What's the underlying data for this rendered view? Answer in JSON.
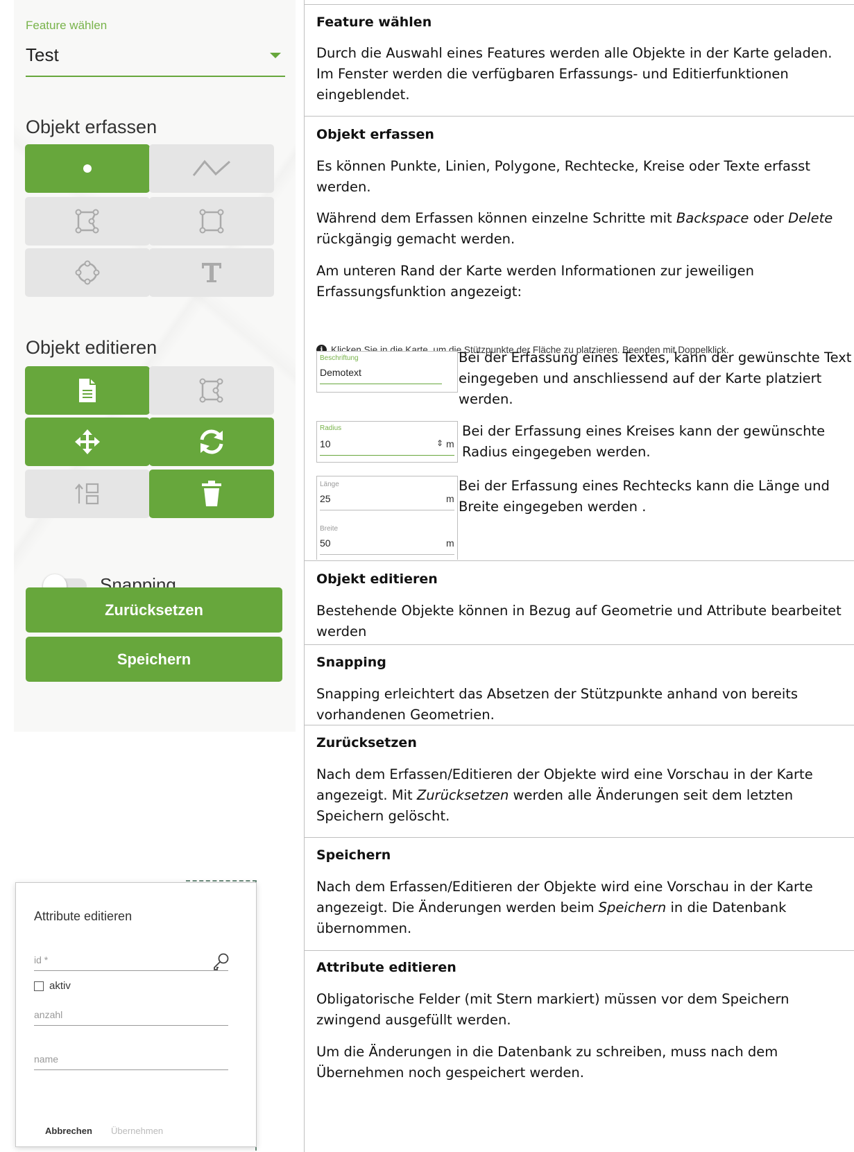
{
  "left": {
    "feature": {
      "label": "Feature wählen",
      "value": "Test"
    },
    "capture": {
      "title": "Objekt erfassen",
      "tools": [
        {
          "icon": "point-icon",
          "active": true
        },
        {
          "icon": "line-icon",
          "active": false
        },
        {
          "icon": "polygon-icon",
          "active": false
        },
        {
          "icon": "rectangle-icon",
          "active": false
        },
        {
          "icon": "circle-icon",
          "active": false
        },
        {
          "icon": "text-icon",
          "active": false
        }
      ]
    },
    "edit": {
      "title": "Objekt editieren",
      "tools": [
        {
          "icon": "document-icon",
          "active": true
        },
        {
          "icon": "edit-polygon-icon",
          "active": false
        },
        {
          "icon": "move-icon",
          "active": true
        },
        {
          "icon": "rotate-icon",
          "active": true
        },
        {
          "icon": "order-icon",
          "active": false
        },
        {
          "icon": "trash-icon",
          "active": true
        }
      ]
    },
    "snapping_label": "Snapping",
    "reset_label": "Zurücksetzen",
    "save_label": "Speichern",
    "dialog": {
      "title": "Attribute editieren",
      "id_label": "id *",
      "aktiv_label": "aktiv",
      "anzahl_label": "anzahl",
      "name_label": "name",
      "cancel_label": "Abbrechen",
      "ok_label": "Übernehmen"
    }
  },
  "right": {
    "feature_title": "Feature wählen",
    "feature_text": "Durch die Auswahl eines Features werden alle Objekte in der Karte geladen. Im Fenster werden die verfügbaren Erfassungs- und Editierfunktionen eingeblendet.",
    "capture_title": "Objekt erfassen",
    "capture_p1": "Es können Punkte, Linien, Polygone, Rechtecke, Kreise oder Texte erfasst werden.",
    "capture_p2_a": "Während dem Erfassen können einzelne Schritte mit ",
    "capture_p2_b": "Backspace",
    "capture_p2_c": " oder ",
    "capture_p2_d": "Delete",
    "capture_p2_e": " rückgängig gemacht werden.",
    "capture_p3": "Am unteren Rand der Karte werden Informationen zur jeweiligen Erfassungsfunktion angezeigt:",
    "info_text": "Klicken Sie in die Karte, um die Stützpunkte der Fläche zu platzieren. Beenden mit Doppelklick.",
    "text_box": {
      "label": "Beschriftung",
      "value": "Demotext"
    },
    "text_desc": "Bei der Erfassung eines Textes, kann der gewünschte Text eingegeben und anschliessend auf der Karte platziert werden.",
    "radius_box": {
      "label": "Radius",
      "value": "10",
      "unit": "m",
      "spinner": "⇕"
    },
    "radius_desc": "Bei der Erfassung eines Kreises kann der gewünschte Radius eingegeben werden.",
    "rect_box": {
      "len_label": "Länge",
      "len_value": "25",
      "width_label": "Breite",
      "width_value": "50",
      "unit": "m"
    },
    "rect_desc": "Bei der Erfassung eines Rechtecks kann die Länge und Breite eingegeben werden .",
    "edit_title": "Objekt editieren",
    "edit_text": "Bestehende Objekte können in Bezug auf Geometrie und Attribute bearbeitet werden",
    "snap_title": "Snapping",
    "snap_text": "Snapping erleichtert das Absetzen der Stützpunkte anhand von bereits vorhandenen Geometrien.",
    "reset_title": "Zurücksetzen",
    "reset_a": "Nach dem Erfassen/Editieren der Objekte wird eine Vorschau in der Karte angezeigt. Mit ",
    "reset_b": "Zurücksetzen",
    "reset_c": " werden alle Änderungen seit dem letzten Speichern gelöscht.",
    "save_title": "Speichern",
    "save_a": "Nach dem Erfassen/Editieren der Objekte wird eine Vorschau in der Karte angezeigt. Die Änderungen werden beim ",
    "save_b": "Speichern",
    "save_c": " in die Datenbank übernommen.",
    "attr_title": "Attribute editieren",
    "attr_p1": "Obligatorische Felder (mit Stern markiert) müssen vor dem Speichern zwingend ausgefüllt werden.",
    "attr_p2": "Um die Änderungen in die Datenbank zu schreiben, muss nach dem Übernehmen noch gespeichert werden."
  },
  "colors": {
    "accent": "#67a73c",
    "inactive": "#e5e5e5",
    "label_green": "#78b34a"
  }
}
